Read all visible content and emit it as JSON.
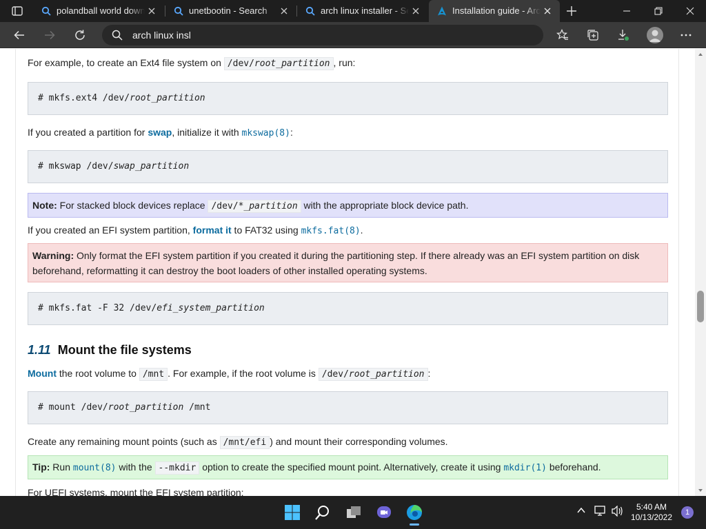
{
  "tabs": [
    {
      "title": "polandball world down"
    },
    {
      "title": "unetbootin - Search"
    },
    {
      "title": "arch linux installer - Sea"
    },
    {
      "title": "Installation guide - Arch"
    }
  ],
  "omnibox": {
    "value": "arch linux insl"
  },
  "article": {
    "p1": {
      "pre": "For example, to create an Ext4 file system on ",
      "code_a": "/dev/",
      "code_b": "root_partition",
      "post": ", run:"
    },
    "pre1": {
      "a": "# mkfs.ext4 /dev/",
      "b": "root_partition"
    },
    "p2": {
      "pre": "If you created a partition for ",
      "link": "swap",
      "mid": ", initialize it with ",
      "mlink": "mkswap(8)",
      "post": ":"
    },
    "pre2": {
      "a": "# mkswap /dev/",
      "b": "swap_partition"
    },
    "note": {
      "label": "Note:",
      "pre": " For stacked block devices replace ",
      "code_a": "/dev/",
      "code_b": "*_partition",
      "post": " with the appropriate block device path."
    },
    "p3": {
      "pre": "If you created an EFI system partition, ",
      "link": "format it",
      "mid": " to FAT32 using ",
      "mlink": "mkfs.fat(8)",
      "post": "."
    },
    "warning": {
      "label": "Warning:",
      "line1": " Only format the EFI system partition if you created it during the partitioning step. If there already was an EFI system partition on disk",
      "line2": "beforehand, reformatting it can destroy the boot loaders of other installed operating systems."
    },
    "pre3": {
      "a": "# mkfs.fat -F 32 /dev/",
      "b": "efi_system_partition"
    },
    "heading": {
      "number": "1.11",
      "title": "Mount the file systems"
    },
    "p4": {
      "link": "Mount",
      "mid": " the root volume to ",
      "code1": "/mnt",
      "mid2": ". For example, if the root volume is ",
      "code2_a": "/dev/",
      "code2_b": "root_partition",
      "post": ":"
    },
    "pre4": {
      "a": "# mount /dev/",
      "b": "root_partition",
      "c": " /mnt"
    },
    "p5": {
      "pre": "Create any remaining mount points (such as ",
      "code": "/mnt/efi",
      "post": ") and mount their corresponding volumes."
    },
    "tip": {
      "label": "Tip:",
      "pre": " Run ",
      "mlink1": "mount(8)",
      "mid": " with the ",
      "code": "--mkdir",
      "mid2": " option to create the specified mount point. Alternatively, create it using ",
      "mlink2": "mkdir(1)",
      "post": " beforehand."
    },
    "p6": {
      "text": "For UEFI systems, mount the EFI system partition:"
    }
  },
  "taskbar": {
    "time": "5:40 AM",
    "date": "10/13/2022",
    "notifications": "1"
  },
  "icons": {
    "tab_actions": "tab-actions-icon",
    "search": "search-icon",
    "arch": "arch-logo-icon",
    "back": "back-arrow-icon",
    "forward": "forward-arrow-icon",
    "refresh": "refresh-icon",
    "favorites": "favorites-icon",
    "collections": "collections-icon",
    "downloads": "download-icon",
    "profile": "profile-icon",
    "menu": "more-icon"
  },
  "colors": {
    "link": "#0c6b9e",
    "note_bg": "#e1e1fa",
    "warning_bg": "#f9dddd",
    "tip_bg": "#ddf8dd",
    "code_bg": "#ebeef2"
  }
}
